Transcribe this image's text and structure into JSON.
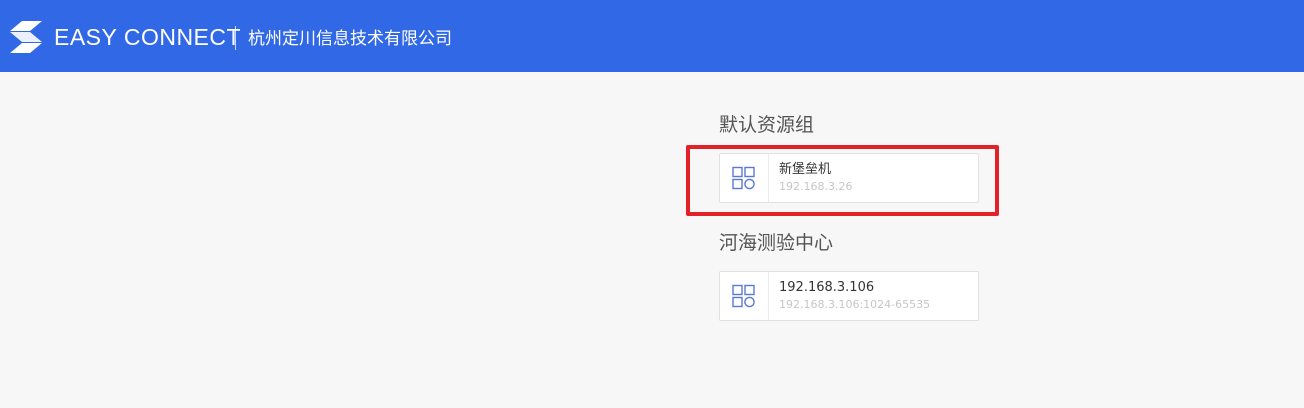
{
  "header": {
    "logo_icon": "easyconnect-s-logo-icon",
    "brand": "EASY CONNECT",
    "company": "杭州定川信息技术有限公司",
    "background_color": "#3168e6"
  },
  "groups": [
    {
      "title": "默认资源组",
      "resources": [
        {
          "name": "新堡垒机",
          "address": "192.168.3.26",
          "icon": "apps-grid-icon",
          "highlighted": true
        }
      ]
    },
    {
      "title": "河海测验中心",
      "resources": [
        {
          "name": "192.168.3.106",
          "address": "192.168.3.106:1024-65535",
          "icon": "apps-grid-icon",
          "highlighted": false
        }
      ]
    }
  ],
  "colors": {
    "highlight": "#e32129",
    "icon": "#5b78d6"
  }
}
